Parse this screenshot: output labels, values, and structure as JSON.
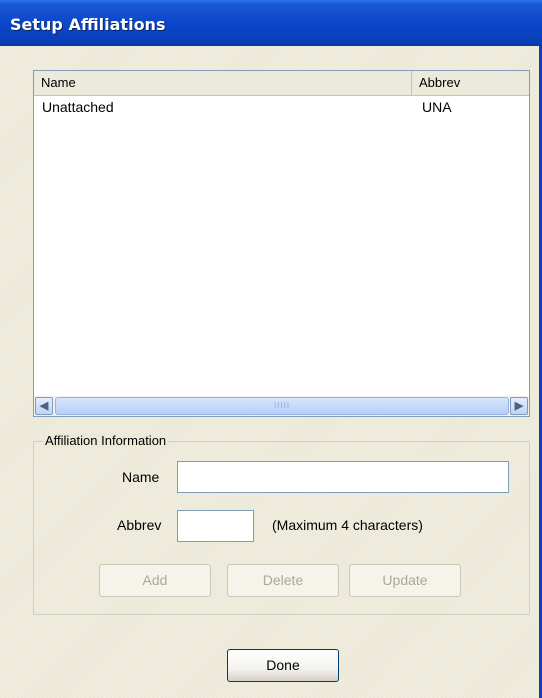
{
  "window": {
    "title": "Setup Affiliations"
  },
  "list": {
    "columns": {
      "name": "Name",
      "abbrev": "Abbrev"
    },
    "rows": [
      {
        "name": "Unattached",
        "abbrev": "UNA"
      }
    ],
    "scrollbar": {
      "grip": "IIIII"
    }
  },
  "affiliation_info": {
    "legend": "Affiliation Information",
    "name_label": "Name",
    "name_value": "",
    "abbrev_label": "Abbrev",
    "abbrev_value": "",
    "abbrev_hint": "(Maximum 4 characters)",
    "add_label": "Add",
    "delete_label": "Delete",
    "update_label": "Update"
  },
  "footer": {
    "done_label": "Done"
  }
}
